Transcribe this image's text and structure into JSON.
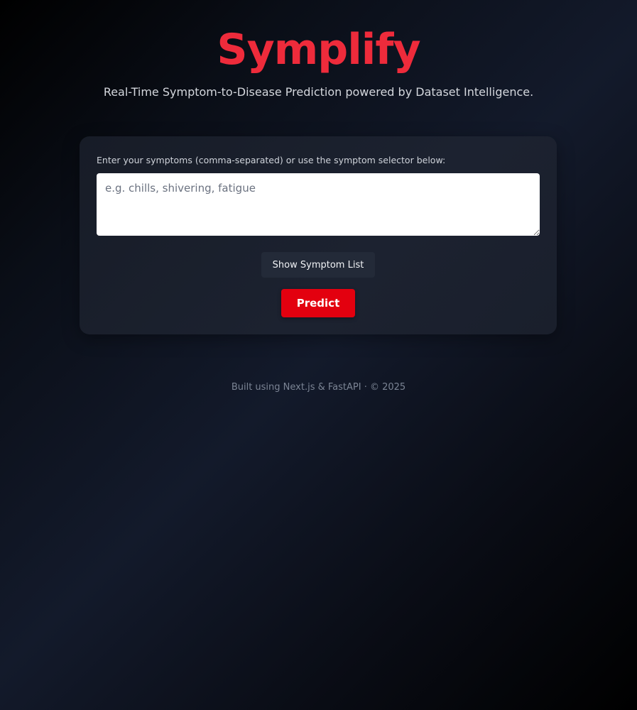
{
  "header": {
    "title": "Symplify",
    "subtitle": "Real-Time Symptom-to-Disease Prediction powered by Dataset Intelligence."
  },
  "form": {
    "label": "Enter your symptoms (comma-separated) or use the symptom selector below:",
    "input_value": "",
    "input_placeholder": "e.g. chills, shivering, fatigue",
    "show_list_label": "Show Symptom List",
    "predict_label": "Predict"
  },
  "footer": {
    "text": "Built using Next.js & FastAPI · © 2025"
  },
  "colors": {
    "accent": "#ee2b3b",
    "predict_button": "#e3000f",
    "card_background": "#1a1f2c",
    "page_background": "#0a0e17"
  }
}
